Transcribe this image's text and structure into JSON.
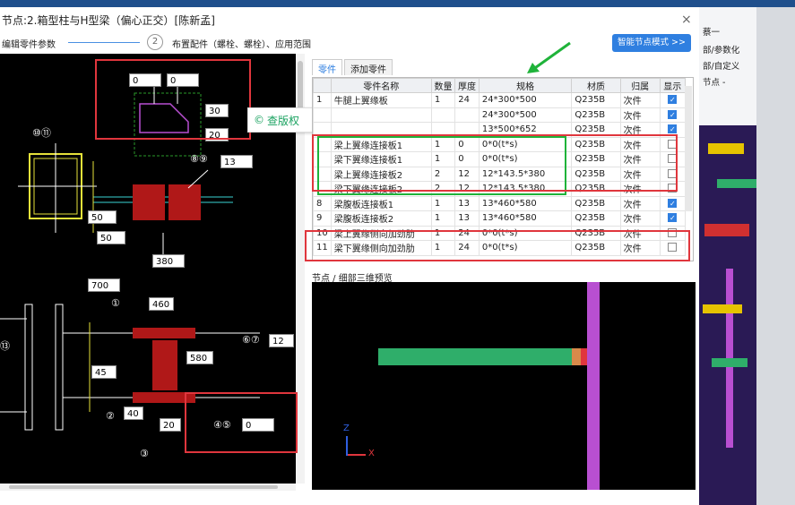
{
  "window": {
    "title": "节点:2.箱型柱与H型梁（偏心正交）[陈新孟]",
    "close": "×"
  },
  "steps": {
    "step1_label": "编辑零件参数",
    "step2_number": "2",
    "step2_label": "布置配件（螺栓、螺栓）、应用范围"
  },
  "smart_button": "智能节点模式 >>",
  "cad_annotations": {
    "top_left": "0",
    "top_right": "0",
    "dim_30": "30",
    "dim_20": "20",
    "dim_13": "13",
    "dim_50a": "50",
    "dim_50b": "50",
    "dim_380": "380",
    "dim_700": "700",
    "dim_460": "460",
    "dim_580": "580",
    "dim_12": "12",
    "dim_45": "45",
    "dim_40": "40",
    "dim_20b": "20",
    "dim_0b": "0",
    "callout_10_11": "⑩⑪",
    "callout_8_9": "⑧⑨",
    "callout_1": "①",
    "callout_6_7": "⑥⑦",
    "callout_2": "②",
    "callout_4_5": "④⑤",
    "callout_3": "③",
    "callout_13": "⑬"
  },
  "toolbar": {
    "brand": "查版权"
  },
  "tabs": [
    "零件",
    "添加零件"
  ],
  "table": {
    "headers": [
      "",
      "零件名称",
      "数量",
      "厚度",
      "规格",
      "材质",
      "归属",
      "显示"
    ],
    "rows": [
      {
        "no": "1",
        "name": "牛腿上翼缘板",
        "qty": "1",
        "thk": "24",
        "spec": "24*300*500",
        "mat": "Q235B",
        "own": "次件",
        "show": true
      },
      {
        "no": "",
        "name": "",
        "qty": "",
        "thk": "",
        "spec": "24*300*500",
        "mat": "Q235B",
        "own": "次件",
        "show": true
      },
      {
        "no": "",
        "name": "",
        "qty": "",
        "thk": "",
        "spec": "13*500*652",
        "mat": "Q235B",
        "own": "次件",
        "show": true
      },
      {
        "no": "",
        "name": "梁上翼缘连接板1",
        "qty": "1",
        "thk": "0",
        "spec": "0*0(t*s)",
        "mat": "Q235B",
        "own": "次件",
        "show": false
      },
      {
        "no": "",
        "name": "梁下翼缘连接板1",
        "qty": "1",
        "thk": "0",
        "spec": "0*0(t*s)",
        "mat": "Q235B",
        "own": "次件",
        "show": false
      },
      {
        "no": "",
        "name": "梁上翼缘连接板2",
        "qty": "2",
        "thk": "12",
        "spec": "12*143.5*380",
        "mat": "Q235B",
        "own": "次件",
        "show": false
      },
      {
        "no": "",
        "name": "梁下翼缘连接板2",
        "qty": "2",
        "thk": "12",
        "spec": "12*143.5*380",
        "mat": "Q235B",
        "own": "次件",
        "show": false
      },
      {
        "no": "8",
        "name": "梁腹板连接板1",
        "qty": "1",
        "thk": "13",
        "spec": "13*460*580",
        "mat": "Q235B",
        "own": "次件",
        "show": true
      },
      {
        "no": "9",
        "name": "梁腹板连接板2",
        "qty": "1",
        "thk": "13",
        "spec": "13*460*580",
        "mat": "Q235B",
        "own": "次件",
        "show": true
      },
      {
        "no": "10",
        "name": "梁上翼缘侧向加劲肋",
        "qty": "1",
        "thk": "24",
        "spec": "0*0(t*s)",
        "mat": "Q235B",
        "own": "次件",
        "show": false
      },
      {
        "no": "11",
        "name": "梁下翼缘侧向加劲肋",
        "qty": "1",
        "thk": "24",
        "spec": "0*0(t*s)",
        "mat": "Q235B",
        "own": "次件",
        "show": false
      }
    ]
  },
  "preview": {
    "label": "节点 / 细部三维预览",
    "axis_z": "Z",
    "axis_x": "X"
  },
  "right_panel": {
    "items": [
      "部/参数化",
      "部/自定义",
      "节点 -"
    ],
    "user": "蔡一"
  },
  "colors": {
    "accent": "#2f7fe0",
    "highlight_red": "#e0363d",
    "highlight_green": "#1fb33a",
    "beam_green": "#2fae6a",
    "column_purple": "#b84fd1"
  }
}
